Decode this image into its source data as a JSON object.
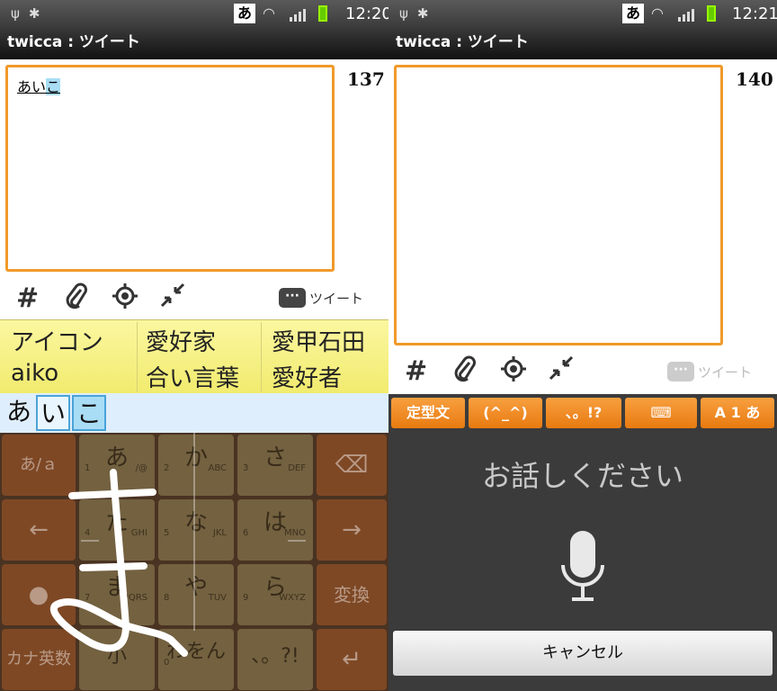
{
  "left": {
    "status": {
      "ime": "あ",
      "time": "12:20"
    },
    "title": "twicca : ツイート",
    "compose": {
      "prefix": "あい",
      "highlight": "こ"
    },
    "char_count": "137",
    "tweet_label": "ツイート",
    "hash_icon": "#",
    "candidates": {
      "row1": [
        "アイコン",
        "愛好家",
        "愛甲石田"
      ],
      "row2": [
        "aiko",
        "合い言葉",
        "愛好者"
      ]
    },
    "composing": [
      "あ",
      "い",
      "こ"
    ],
    "keys": {
      "main": [
        "あ",
        "か",
        "さ",
        "た",
        "な",
        "は",
        "ま",
        "や",
        "ら",
        "小",
        "わをん",
        "、。?!"
      ],
      "subs": {
        "a": [
          "1",
          "/@"
        ],
        "ka": [
          "2",
          "ABC"
        ],
        "sa": [
          "3",
          "DEF"
        ],
        "ta": [
          "4",
          "GHI"
        ],
        "na": [
          "5",
          "JKL"
        ],
        "ha": [
          "6",
          "MNO"
        ],
        "ma": [
          "7",
          "PQRS"
        ],
        "ya": [
          "8",
          "TUV"
        ],
        "ra": [
          "9",
          "WXYZ"
        ],
        "wa": [
          "0",
          ""
        ]
      },
      "left_col": [
        "あ/ａ",
        "←",
        "",
        "カナ英数"
      ],
      "right_col": [
        "⌫",
        "→",
        "変換",
        "↵"
      ]
    }
  },
  "right": {
    "status": {
      "ime": "あ",
      "time": "12:21"
    },
    "title": "twicca : ツイート",
    "char_count": "140",
    "tweet_label": "ツイート",
    "hash_icon": "#",
    "toolbar": [
      "定型文",
      "(^_^)",
      "、。!?",
      "⌨",
      "A 1 あ"
    ],
    "voice_prompt": "お話しください",
    "cancel_label": "キャンセル"
  }
}
